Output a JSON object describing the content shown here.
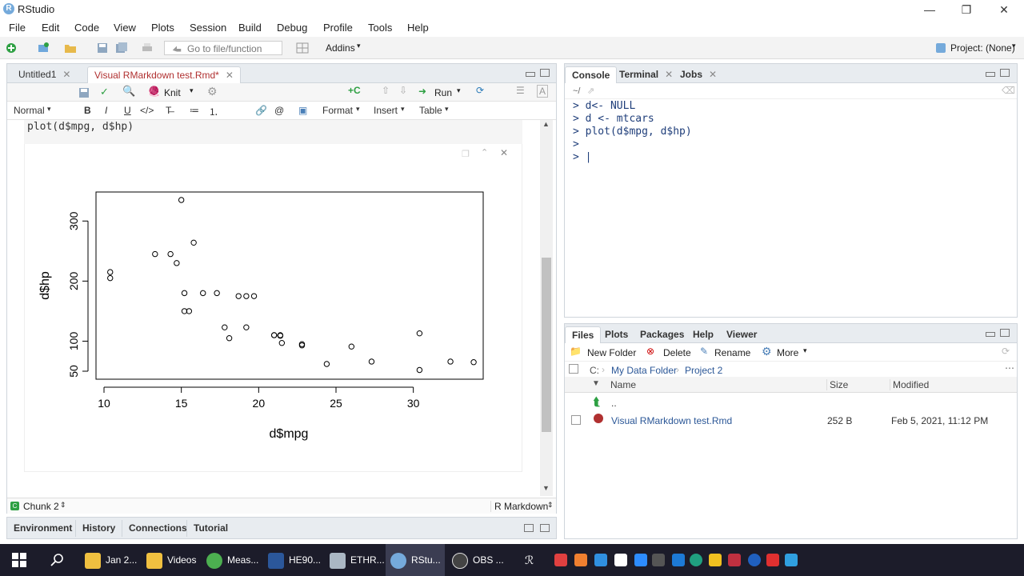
{
  "window": {
    "title": "RStudio",
    "logo": "R"
  },
  "menu": [
    "File",
    "Edit",
    "Code",
    "View",
    "Plots",
    "Session",
    "Build",
    "Debug",
    "Profile",
    "Tools",
    "Help"
  ],
  "toolbar": {
    "goto_placeholder": "Go to file/function",
    "addins": "Addins",
    "project": "Project: (None)"
  },
  "editor": {
    "tabs": [
      "Untitled1",
      "Visual RMarkdown test.Rmd*"
    ],
    "knit": "Knit",
    "run": "Run",
    "format_bar": {
      "style": "Normal",
      "bold": "B",
      "italic": "I",
      "underline": "U",
      "format": "Format",
      "insert": "Insert",
      "table": "Table"
    },
    "code_line": "plot(d$mpg, d$hp)",
    "status": {
      "chunk": "Chunk 2",
      "mode": "R Markdown"
    }
  },
  "bottom_left_tabs": [
    "Environment",
    "History",
    "Connections",
    "Tutorial"
  ],
  "console": {
    "tabs": [
      "Console",
      "Terminal",
      "Jobs"
    ],
    "path": "~/",
    "lines": [
      "> d<- NULL",
      "> d <- mtcars",
      "> plot(d$mpg, d$hp)",
      ">",
      "> |"
    ]
  },
  "files": {
    "tabs": [
      "Files",
      "Plots",
      "Packages",
      "Help",
      "Viewer"
    ],
    "actions": [
      "New Folder",
      "Delete",
      "Rename",
      "More"
    ],
    "breadcrumb": [
      "C:",
      "My Data Folder",
      "Project 2"
    ],
    "columns": [
      "Name",
      "Size",
      "Modified"
    ],
    "up": "..",
    "rows": [
      {
        "name": "Visual RMarkdown test.Rmd",
        "size": "252 B",
        "modified": "Feb 5, 2021, 11:12 PM"
      }
    ]
  },
  "taskbar": {
    "items": [
      "Jan 2...",
      "Videos",
      "Meas...",
      "HE90...",
      "ETHR...",
      "RStu...",
      "OBS ..."
    ],
    "colors": [
      "#f0c040",
      "#f0c040",
      "#4caf50",
      "#2b579a",
      "#aab7c4",
      "#75aadb",
      "#444444"
    ]
  },
  "chart_data": {
    "type": "scatter",
    "xlabel": "d$mpg",
    "ylabel": "d$hp",
    "xlim": [
      10,
      34
    ],
    "ylim": [
      50,
      335
    ],
    "xticks": [
      10,
      15,
      20,
      25,
      30
    ],
    "yticks": [
      50,
      100,
      200,
      300
    ],
    "points": [
      [
        21,
        110
      ],
      [
        21,
        110
      ],
      [
        22.8,
        93
      ],
      [
        21.4,
        110
      ],
      [
        18.7,
        175
      ],
      [
        18.1,
        105
      ],
      [
        14.3,
        245
      ],
      [
        24.4,
        62
      ],
      [
        22.8,
        95
      ],
      [
        19.2,
        123
      ],
      [
        17.8,
        123
      ],
      [
        16.4,
        180
      ],
      [
        17.3,
        180
      ],
      [
        15.2,
        180
      ],
      [
        10.4,
        205
      ],
      [
        10.4,
        215
      ],
      [
        14.7,
        230
      ],
      [
        32.4,
        66
      ],
      [
        30.4,
        52
      ],
      [
        33.9,
        65
      ],
      [
        21.5,
        97
      ],
      [
        15.5,
        150
      ],
      [
        15.2,
        150
      ],
      [
        13.3,
        245
      ],
      [
        19.2,
        175
      ],
      [
        27.3,
        66
      ],
      [
        26,
        91
      ],
      [
        30.4,
        113
      ],
      [
        15.8,
        264
      ],
      [
        19.7,
        175
      ],
      [
        15,
        335
      ],
      [
        21.4,
        109
      ]
    ]
  }
}
